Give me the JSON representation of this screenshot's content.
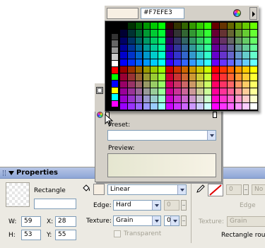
{
  "palette": {
    "hex_value": "#F7EFE3",
    "selected_color": "#F7EFE3",
    "system_colors": [
      "#000000",
      "#333333",
      "#666666",
      "#999999",
      "#cccccc",
      "#ffffff",
      "#ff0000",
      "#00ff00",
      "#0000ff",
      "#ffff00",
      "#00ffff",
      "#ff00ff"
    ]
  },
  "fill_panel": {
    "preset_label": "Preset:",
    "preset_value": "",
    "preview_label": "Preview:",
    "preview_gradient_start": "#e5e6d0",
    "preview_gradient_end": "#f7f3e6"
  },
  "properties": {
    "title": "Properties",
    "shape_name": "Rectangle",
    "instance_name": "",
    "w_label": "W:",
    "w_value": "59",
    "x_label": "X:",
    "x_value": "28",
    "h_label": "H:",
    "h_value": "53",
    "y_label": "Y:",
    "y_value": "55",
    "fill_type": "Linear",
    "edge_label": "Edge:",
    "edge_value": "Hard",
    "edge_amount": "0",
    "texture_label": "Texture:",
    "texture_value": "Grain",
    "texture_amount": "0",
    "transparent_label": "Transparent",
    "stroke_width": "0",
    "stroke_style": "No",
    "edge_label_2": "Edge",
    "texture_label_2": "Texture:",
    "texture_value_2": "Grain",
    "rect_roundness_label": "Rectangle rou"
  },
  "colors": {
    "panel_bg": "#d4d0c8",
    "header_gradient_start": "#5d7fc6",
    "header_gradient_end": "#c8d3ea"
  }
}
